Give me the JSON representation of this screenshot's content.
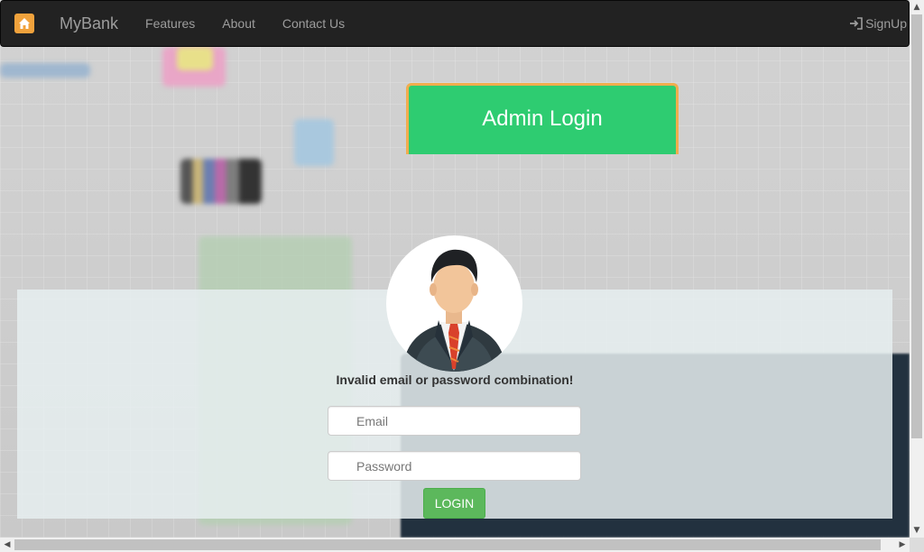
{
  "navbar": {
    "brand": "MyBank",
    "links": [
      "Features",
      "About",
      "Contact Us"
    ],
    "signup_label": "SignUp",
    "logo_icon": "home-icon",
    "signup_icon": "sign-in-icon",
    "background_color": "#222222"
  },
  "admin_header": {
    "title": "Admin Login",
    "color": "#2ecc71",
    "border_color": "#f0ad4e"
  },
  "login_form": {
    "avatar_icon": "user-avatar-icon",
    "error_message": "Invalid email or password combination!",
    "email_placeholder": "Email",
    "password_placeholder": "Password",
    "submit_label": "LOGIN",
    "submit_color": "#5cb85c"
  }
}
